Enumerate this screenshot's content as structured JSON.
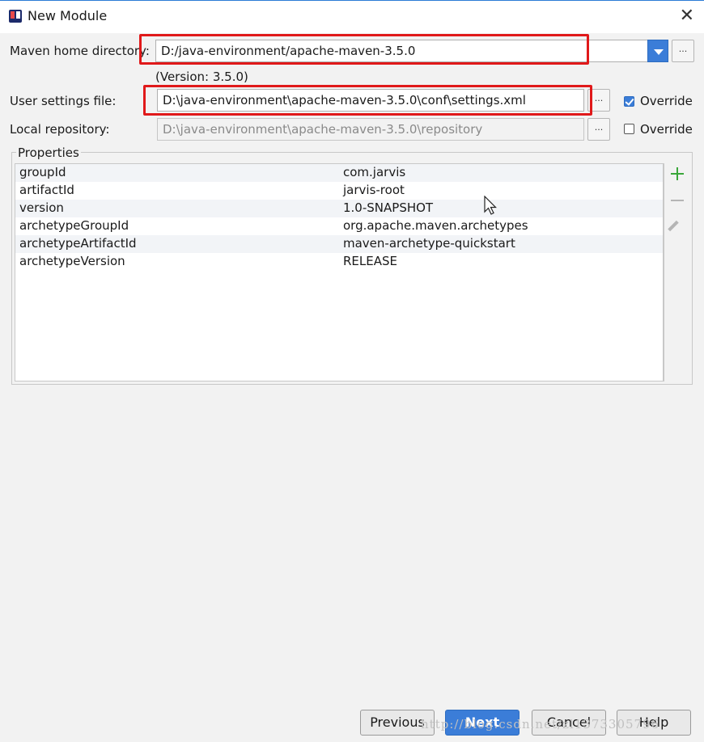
{
  "window": {
    "title": "New Module"
  },
  "maven_home": {
    "label": "Maven home directory:",
    "value": "D:/java-environment/apache-maven-3.5.0",
    "version_note": "(Version: 3.5.0)"
  },
  "user_settings": {
    "label": "User settings file:",
    "value": "D:\\java-environment\\apache-maven-3.5.0\\conf\\settings.xml",
    "override_label": "Override",
    "override_checked": true
  },
  "local_repo": {
    "label": "Local repository:",
    "value": "D:\\java-environment\\apache-maven-3.5.0\\repository",
    "override_label": "Override",
    "override_checked": false
  },
  "browse_label": "...",
  "properties": {
    "title": "Properties",
    "rows": [
      {
        "key": "groupId",
        "value": "com.jarvis"
      },
      {
        "key": "artifactId",
        "value": "jarvis-root"
      },
      {
        "key": "version",
        "value": "1.0-SNAPSHOT"
      },
      {
        "key": "archetypeGroupId",
        "value": "org.apache.maven.archetypes"
      },
      {
        "key": "archetypeArtifactId",
        "value": "maven-archetype-quickstart"
      },
      {
        "key": "archetypeVersion",
        "value": "RELEASE"
      }
    ]
  },
  "buttons": {
    "previous": "Previous",
    "next": "Next",
    "cancel": "Cancel",
    "help": "Help"
  },
  "watermark": "http://blog.csdn.net/zl1373305796",
  "colors": {
    "accent": "#3b7dd8",
    "highlight_box": "#e0191a",
    "add_icon": "#3aa73a"
  },
  "icons": [
    "intellij-app-icon",
    "close-icon",
    "chevron-down-icon",
    "checkbox-icon",
    "add-icon",
    "remove-icon",
    "edit-icon",
    "mouse-cursor-icon"
  ]
}
